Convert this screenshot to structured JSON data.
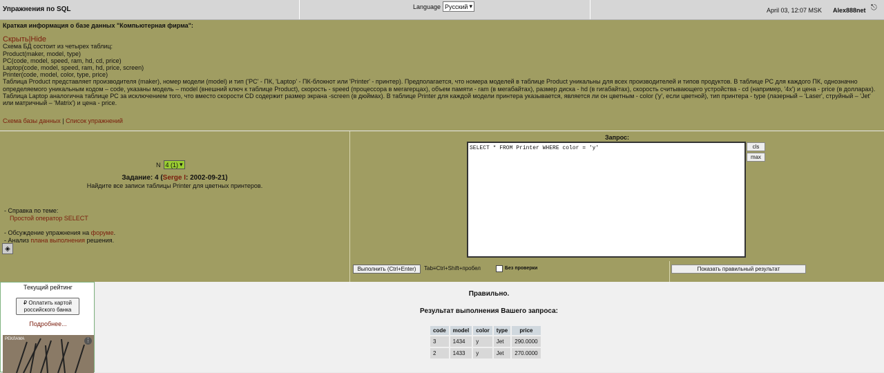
{
  "header": {
    "title": "Упражнения по SQL",
    "language_label": "Language",
    "language_value": "Русский",
    "datetime": "April 03, 12:07 MSK",
    "username": "Alex888net"
  },
  "info": {
    "heading": "Краткая информация о базе данных \"Компьютерная фирма\":",
    "hide_ru": "Скрыть",
    "hide_sep": "|",
    "hide_en": "Hide",
    "schema_lines": [
      "Схема БД состоит из четырех таблиц:",
      "Product(maker, model, type)",
      "PC(code, model, speed, ram, hd, cd, price)",
      "Laptop(code, model, speed, ram, hd, price, screen)",
      "Printer(code, model, color, type, price)"
    ],
    "description": "Таблица Product представляет производителя (maker), номер модели (model) и тип ('PC' - ПК, 'Laptop' - ПК-блокнот или 'Printer' - принтер). Предполагается, что номера моделей в таблице Product уникальны для всех производителей и типов продуктов. В таблице PC для каждого ПК, однозначно определяемого уникальным кодом – code, указаны модель – model (внешний ключ к таблице Product), скорость - speed (процессора в мегагерцах), объем памяти - ram (в мегабайтах), размер диска - hd (в гигабайтах), скорость считывающего устройства - cd (например, '4x') и цена - price (в долларах). Таблица Laptop аналогична таблице РС за исключением того, что вместо скорости CD содержит размер экрана -screen (в дюймах). В таблице Printer для каждой модели принтера указывается, является ли он цветным - color ('y', если цветной), тип принтера - type (лазерный – 'Laser', струйный – 'Jet' или матричный – 'Matrix') и цена - price.",
    "schema_link": "Схема базы данных",
    "links_sep": "|",
    "exercises_link": "Список упражнений"
  },
  "task": {
    "n_label": "N",
    "n_value": "4 (1)",
    "title_prefix": "Задание: 4 (",
    "author": "Serge I",
    "title_suffix": ": 2002-09-21)",
    "description": "Найдите все записи таблицы Printer для цветных принтеров.",
    "help_label": "- Справка по теме:",
    "help_link": "Простой оператор SELECT",
    "forum_prefix": "- Обсуждение упражнения на ",
    "forum_link": "форуме",
    "forum_suffix": ".",
    "plan_prefix": "- Анализ ",
    "plan_link": "плана выполнения",
    "plan_suffix": " решения."
  },
  "query": {
    "label": "Запрос:",
    "sql": "SELECT * FROM Printer WHERE color = 'y'",
    "cls_label": "cls",
    "max_label": "max",
    "execute_label": "Выполнить (Ctrl+Enter)",
    "tab_hint": "Tab≡Ctrl+Shift+пробел",
    "no_check_label": "Без проверки",
    "show_result_label": "Показать правильный результат"
  },
  "sidebar": {
    "rating_label": "Текущий рейтинг",
    "pay_line1": "₽ Оплатить картой",
    "pay_line2": "российского банка",
    "more_link": "Подробнее...",
    "ad_label": "РЕКЛАМА"
  },
  "result": {
    "status": "Правильно.",
    "title": "Результат выполнения Вашего запроса:",
    "columns": [
      "code",
      "model",
      "color",
      "type",
      "price"
    ],
    "rows": [
      [
        "3",
        "1434",
        "y",
        "Jet",
        "290.0000"
      ],
      [
        "2",
        "1433",
        "y",
        "Jet",
        "270.0000"
      ]
    ]
  }
}
